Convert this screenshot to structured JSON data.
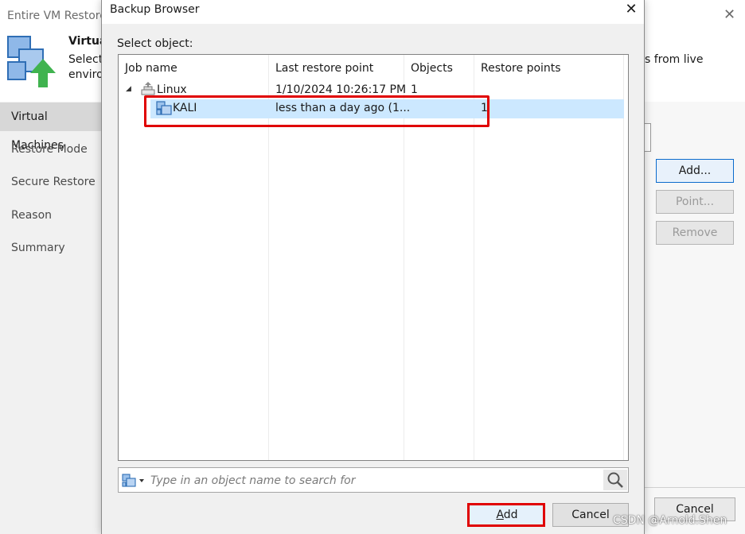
{
  "background_window": {
    "title": "Entire VM Restore",
    "header_title": "Virtua",
    "header_desc_line1": "Select",
    "header_desc_line2": "enviro",
    "header_desc_right": "s from live",
    "steps": [
      "Virtual Machines",
      "Restore Mode",
      "Secure Restore",
      "Reason",
      "Summary"
    ],
    "active_step_index": 0,
    "buttons": {
      "add": "Add...",
      "point": "Point...",
      "remove": "Remove",
      "cancel": "Cancel"
    }
  },
  "dialog": {
    "title": "Backup Browser",
    "select_label": "Select object:",
    "columns": [
      "Job name",
      "Last restore point",
      "Objects",
      "Restore points"
    ],
    "rows": [
      {
        "name": "Linux",
        "last_restore_point": "1/10/2024 10:26:17 PM",
        "objects": "1",
        "restore_points": "",
        "icon": "backup-job-icon",
        "expanded": true
      },
      {
        "name": "KALI",
        "last_restore_point": "less than a day ago (1...",
        "objects": "",
        "restore_points": "1",
        "icon": "vm-icon",
        "selected": true
      }
    ],
    "search": {
      "placeholder": "Type in an object name to search for",
      "value": ""
    },
    "buttons": {
      "add_underlined": "A",
      "add_rest": "dd",
      "cancel": "Cancel"
    }
  },
  "watermark": "CSDN @Arnold.Shen",
  "colors": {
    "selection": "#cce8ff",
    "highlight": "#e00000",
    "accent": "#0b6bcc",
    "veeam_green": "#40b34f",
    "veeam_blue": "#2f6eb5"
  }
}
